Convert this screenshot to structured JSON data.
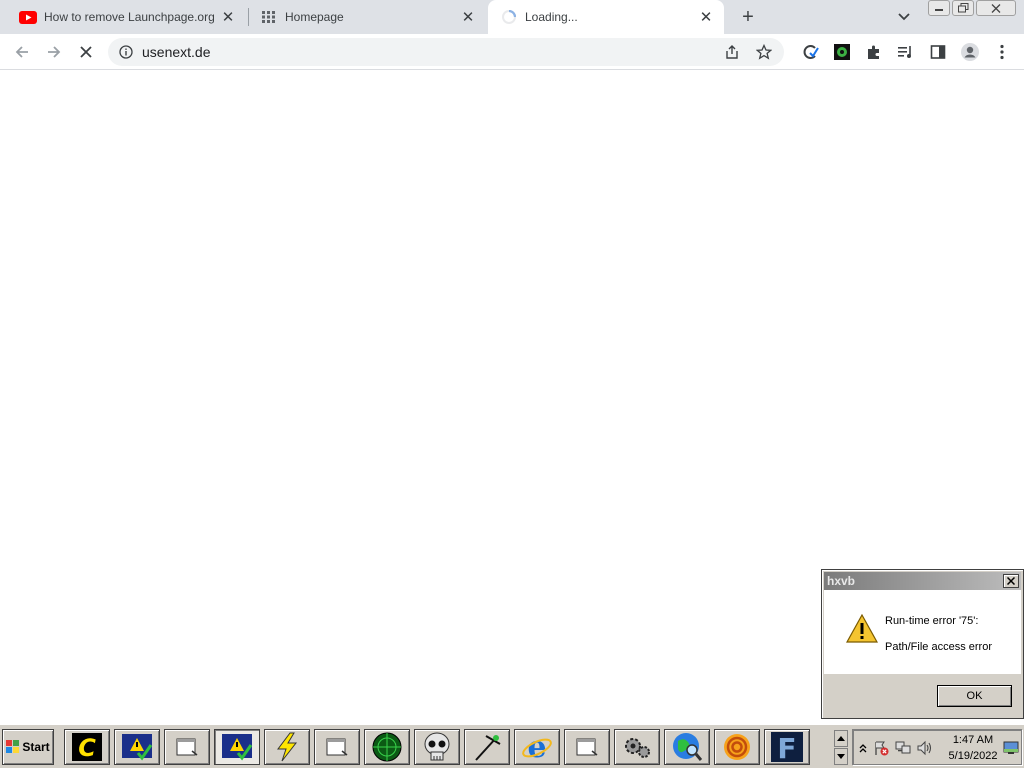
{
  "browser": {
    "tabs": [
      {
        "title": "How to remove Launchpage.org (Chrome)",
        "icon": "youtube-icon",
        "active": false
      },
      {
        "title": "Homepage",
        "icon": "grid-icon",
        "active": false
      },
      {
        "title": "Loading...",
        "icon": "loading-spinner-icon",
        "active": true
      }
    ],
    "url": "usenext.de"
  },
  "dialog": {
    "title": "hxvb",
    "message_line1": "Run-time error '75':",
    "message_line2": "Path/File access error",
    "ok_label": "OK"
  },
  "taskbar": {
    "start_label": "Start",
    "clock_time": "1:47 AM",
    "clock_date": "5/19/2022"
  },
  "colors": {
    "tabstrip": "#dee1e6",
    "omnibox": "#f1f3f4",
    "youtube_red": "#ff0000",
    "classic_gray": "#d4d0c8",
    "warning_yellow": "#f4c430"
  }
}
